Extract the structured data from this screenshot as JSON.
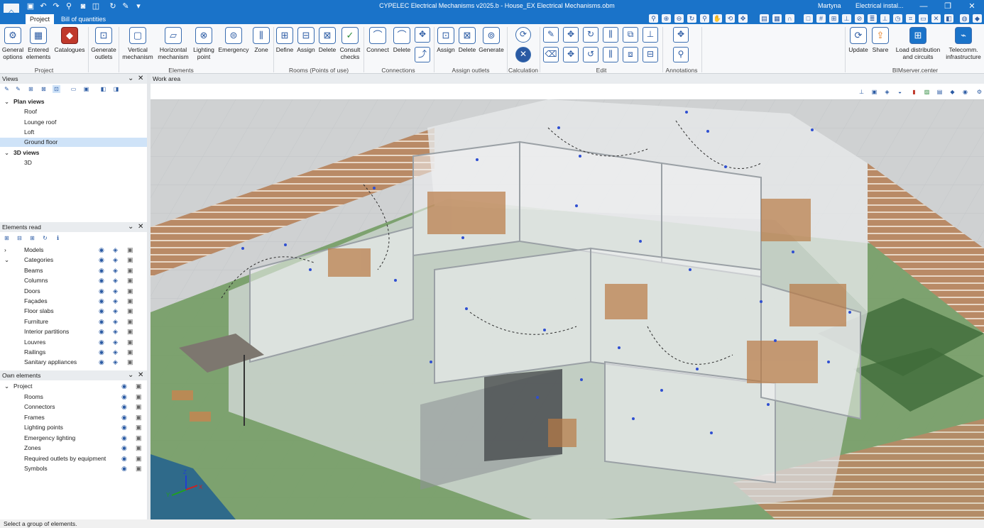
{
  "window": {
    "title": "CYPELEC Electrical Mechanisms v2025.b - House_EX Electrical Mechanisms.obm",
    "user": "Martyna",
    "project_name": "Electrical instal...",
    "controls": {
      "minimize": "—",
      "restore": "❐",
      "close": "✕"
    }
  },
  "tabs": [
    "Project",
    "Bill of quantities"
  ],
  "ribbon": {
    "project": {
      "label": "Project",
      "items": [
        "General options",
        "Entered elements",
        "Catalogues"
      ]
    },
    "elements": {
      "label": "Elements",
      "items": [
        "Generate outlets",
        "Vertical mechanism",
        "Horizontal mechanism",
        "Lighting point",
        "Emergency",
        "Zone"
      ]
    },
    "rooms": {
      "label": "Rooms (Points of use)",
      "items": [
        "Define",
        "Assign",
        "Delete",
        "Consult checks"
      ]
    },
    "connections": {
      "label": "Connections",
      "items": [
        "Connect",
        "Delete"
      ]
    },
    "assign_outlets": {
      "label": "Assign outlets",
      "items": [
        "Assign",
        "Delete",
        "Generate"
      ]
    },
    "calculation": {
      "label": "Calculation"
    },
    "edit": {
      "label": "Edit"
    },
    "annotations": {
      "label": "Annotations"
    },
    "bimserver": {
      "label": "BIMserver.center",
      "items": [
        "Update",
        "Share",
        "Load distribution and circuits",
        "Telecomm. infrastructure"
      ]
    }
  },
  "views_panel": {
    "title": "Views",
    "groups": [
      {
        "label": "Plan views",
        "items": [
          "Roof",
          "Lounge roof",
          "Loft",
          "Ground floor"
        ]
      },
      {
        "label": "3D views",
        "items": [
          "3D"
        ]
      }
    ],
    "selected": "Ground floor"
  },
  "elements_panel": {
    "title": "Elements read",
    "models_label": "Models",
    "categories_label": "Categories",
    "categories": [
      "Beams",
      "Columns",
      "Doors",
      "Façades",
      "Floor slabs",
      "Furniture",
      "Interior partitions",
      "Louvres",
      "Railings",
      "Sanitary appliances"
    ]
  },
  "own_panel": {
    "title": "Own elements",
    "project_label": "Project",
    "items": [
      "Rooms",
      "Connectors",
      "Frames",
      "Lighting points",
      "Emergency lighting",
      "Zones",
      "Required outlets by equipment",
      "Symbols"
    ]
  },
  "work_area": {
    "title": "Work area"
  },
  "status": {
    "text": "Select a group of elements."
  },
  "axes": {
    "z": "Z",
    "y": "Y",
    "x": "X"
  },
  "colors": {
    "accent": "#1a73c9",
    "selection": "#cfe3f8",
    "ground": "#6f9a5e",
    "wall": "#c9ccd0"
  }
}
